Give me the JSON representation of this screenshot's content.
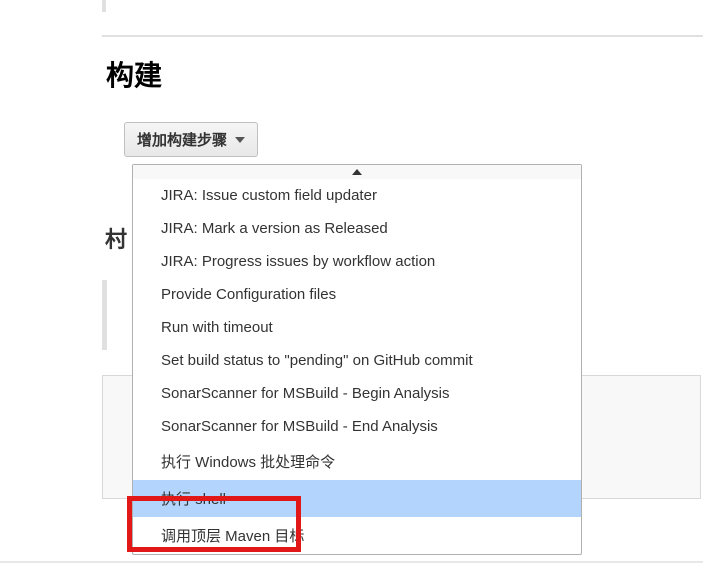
{
  "section": {
    "title": "构建"
  },
  "add_button": {
    "label": "增加构建步骤"
  },
  "obscured_partial": "村",
  "dropdown": {
    "items": [
      {
        "label": "JIRA: Issue custom field updater",
        "selected": false
      },
      {
        "label": "JIRA: Mark a version as Released",
        "selected": false
      },
      {
        "label": "JIRA: Progress issues by workflow action",
        "selected": false
      },
      {
        "label": "Provide Configuration files",
        "selected": false
      },
      {
        "label": "Run with timeout",
        "selected": false
      },
      {
        "label": "Set build status to \"pending\" on GitHub commit",
        "selected": false
      },
      {
        "label": "SonarScanner for MSBuild - Begin Analysis",
        "selected": false
      },
      {
        "label": "SonarScanner for MSBuild - End Analysis",
        "selected": false
      },
      {
        "label": "执行 Windows 批处理命令",
        "selected": false
      },
      {
        "label": "执行 shell",
        "selected": true
      },
      {
        "label": "调用顶层 Maven 目标",
        "selected": false
      }
    ]
  }
}
